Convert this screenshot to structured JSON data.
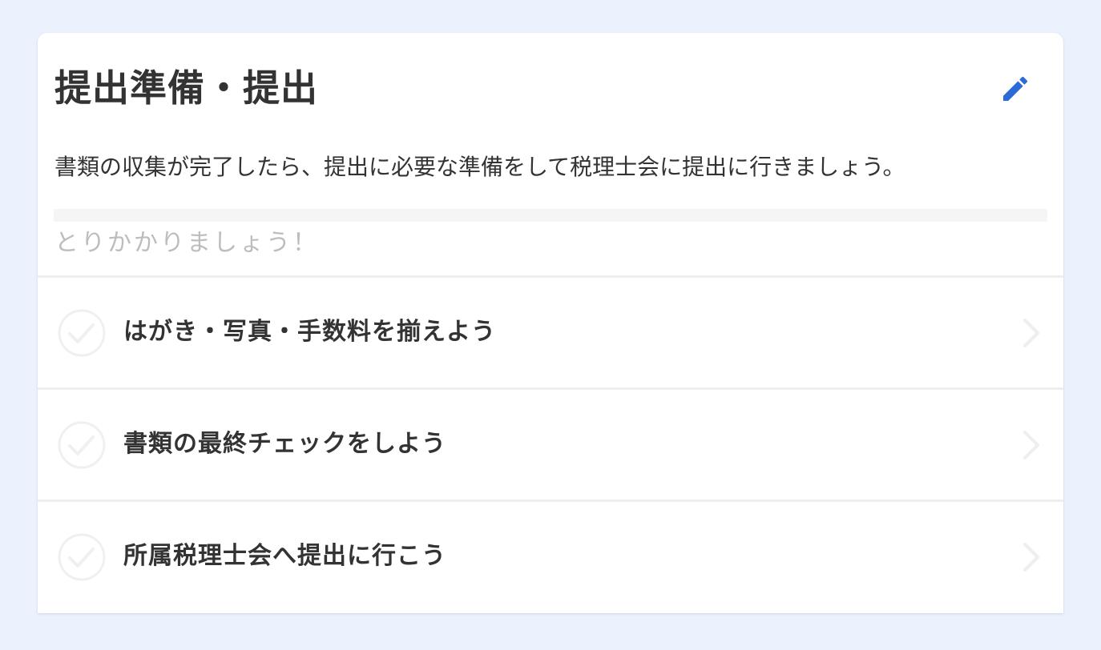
{
  "section": {
    "title": "提出準備・提出",
    "description": "書類の収集が完了したら、提出に必要な準備をして税理士会に提出に行きましょう。",
    "edit_icon": "pencil-icon",
    "progress": {
      "fraction": 0,
      "status_text": "とりかかりましょう！"
    }
  },
  "tasks": [
    {
      "label": "はがき・写真・手数料を揃えよう",
      "completed": false
    },
    {
      "label": "書類の最終チェックをしよう",
      "completed": false
    },
    {
      "label": "所属税理士会へ提出に行こう",
      "completed": false
    }
  ],
  "colors": {
    "accent": "#2b6bd6",
    "page_background": "#ebf1fd",
    "text_primary": "#333333",
    "text_muted": "#bdbdbd",
    "check_inactive": "#f0f0f0"
  }
}
